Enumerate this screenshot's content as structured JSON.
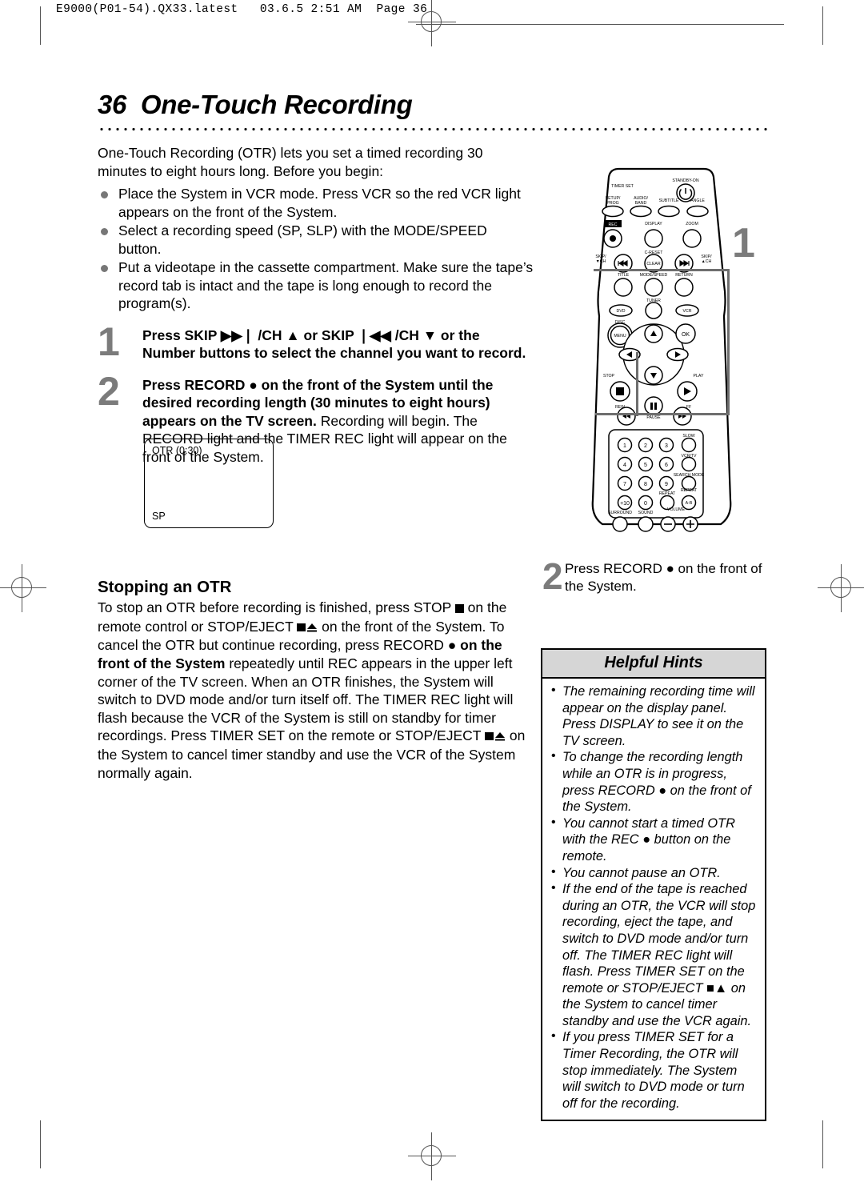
{
  "printer_header": "E9000(P01-54).QX33.latest   03.6.5 2:51 AM  Page 36",
  "page": {
    "number": "36",
    "title": "One-Touch Recording"
  },
  "intro": {
    "paragraph": "One-Touch Recording (OTR) lets you set a timed recording 30 minutes to eight hours long. Before you begin:",
    "bullets": [
      "Place the System in VCR mode. Press VCR so the red VCR light appears on the front of the System.",
      "Select a recording speed (SP, SLP) with the MODE/SPEED button.",
      "Put a videotape in the cassette compartment. Make sure the tape’s record tab is intact and the tape is long enough to record the program(s)."
    ]
  },
  "steps": [
    {
      "number": "1",
      "bold_part": "Press SKIP ▶▶❘ /CH ▲ or SKIP ❘◀◀ /CH ▼ or the Number buttons to select the channel you want to record.",
      "rest": ""
    },
    {
      "number": "2",
      "bold_part": "Press RECORD ● on the front of the System until the desired recording length (30 minutes to eight hours) appears on the TV screen.",
      "rest": " Recording will begin. The RECORD light and the TIMER REC light will appear on the front of the System."
    }
  ],
  "tv_screen": {
    "top_label": "OTR (0:30)",
    "bottom_label": "SP"
  },
  "stopping": {
    "heading": "Stopping an OTR",
    "para1_a": "To stop an OTR before recording is finished, press STOP ",
    "para1_b": " on the remote control or STOP/EJECT ",
    "para1_c": " on the front of the System. To cancel the OTR but continue recording, press RECORD ● ",
    "para1_bold": "on the front of the System",
    "para1_d": " repeatedly until REC appears in the upper left corner of the TV screen.",
    "para2_a": "When an OTR finishes, the System will switch to DVD mode and/or turn itself off. The TIMER REC light will flash because the VCR of the System is still on standby for timer recordings. Press TIMER SET on the remote or STOP/EJECT ",
    "para2_b": " on the System to cancel timer standby and use the VCR of the System normally again."
  },
  "right_step": {
    "number": "2",
    "text": "Press RECORD ● on the front of the System."
  },
  "callout": {
    "remote_number": "1"
  },
  "hints": {
    "heading": "Helpful Hints",
    "items": [
      "The remaining recording time will appear on the display panel. Press DISPLAY to see it on the TV screen.",
      "To change the recording length while an OTR is in progress, press RECORD ● on the front of the System.",
      "You cannot start a timed OTR with the REC ● button on the remote.",
      "You cannot pause an OTR.",
      "If the end of the tape is reached during an OTR, the VCR will stop recording, eject the tape, and switch to DVD mode and/or turn off. The TIMER REC light will flash. Press TIMER SET on the remote or STOP/EJECT ■▲ on the System to cancel timer standby and use the VCR again.",
      "If you press TIMER SET for a Timer Recording, the OTR will stop immediately. The System will switch to DVD mode or turn off for the recording."
    ]
  },
  "remote": {
    "labels": {
      "timer_set": "TIMER SET",
      "standby_on": "STANDBY-ON",
      "setup_prog": "SETUP/ PROG",
      "audio_band": "AUDIO/ BAND",
      "subtitle": "SUBTITLE",
      "angle": "ANGLE",
      "rec": "REC",
      "display": "DISPLAY",
      "zoom": "ZOOM",
      "c_reset": "C-RESET",
      "skip_down_ch": "SKIP/ ▼CH",
      "clear": "CLEAR",
      "skip_up_ch": "SKIP/ ▲CH",
      "title": "TITLE",
      "mode_speed": "MODE/SPEED",
      "return": "RETURN",
      "dvd": "DVD",
      "tuner": "TUNER",
      "vcr": "VCR",
      "disc_menu": "DISC MENU",
      "ok": "OK",
      "stop": "STOP",
      "play": "PLAY",
      "rew": "REW",
      "pause": "PAUSE",
      "ff": "FF",
      "slow": "SLOW",
      "vcr_tv": "VCR/TV",
      "search_mode": "SEARCH MODE",
      "repeat": "REPEAT",
      "repeat_ab": "REPEAT A-B",
      "surround": "SURROUND",
      "sound": "SOUND",
      "volume": "VOLUME",
      "keys": [
        "1",
        "2",
        "3",
        "4",
        "5",
        "6",
        "7",
        "8",
        "9",
        "+10",
        "0"
      ],
      "vol_minus": "−",
      "vol_plus": "+"
    }
  }
}
